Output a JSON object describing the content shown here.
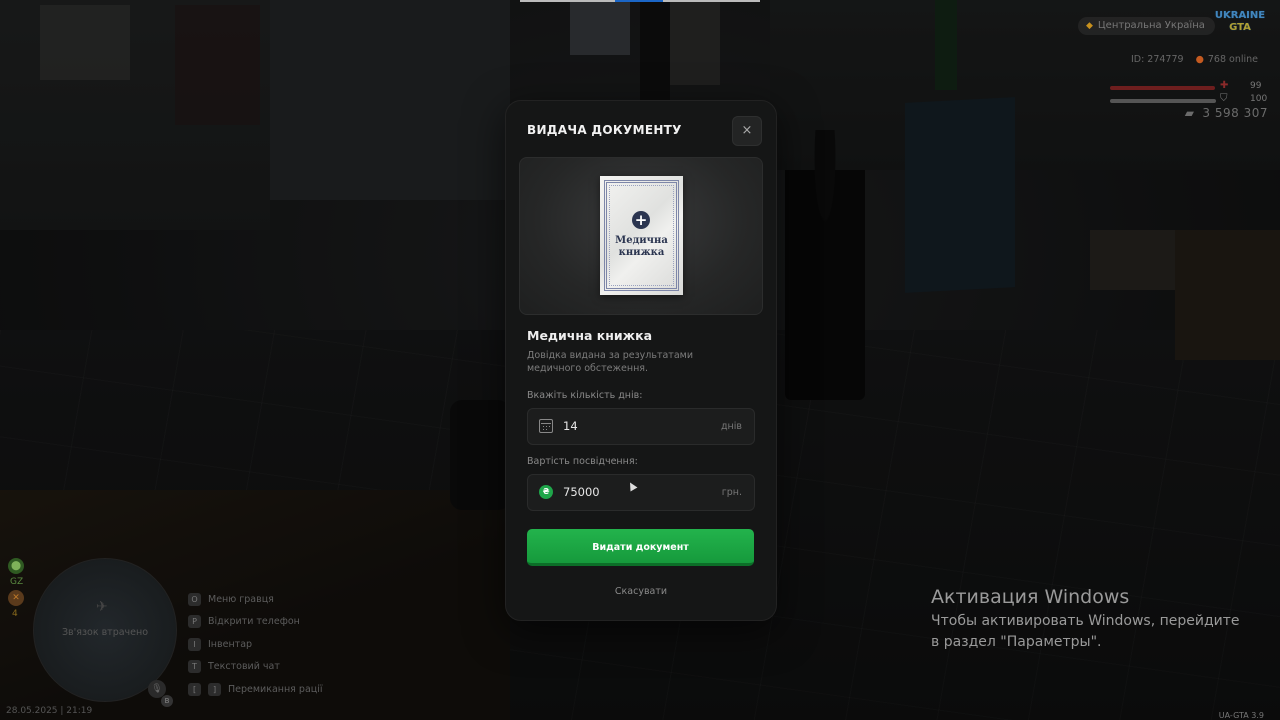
{
  "modal": {
    "title": "ВИДАЧА ДОКУМЕНТУ",
    "close_label": "×",
    "document_card_title": "Медична книжка",
    "document_name": "Медична книжка",
    "document_description": "Довідка видана за результатами медичного обстеження.",
    "days_field": {
      "label": "Вкажіть кількість днів:",
      "value": "14",
      "unit": "днів",
      "icon": "calendar-icon"
    },
    "price_field": {
      "label": "Вартість посвідчення:",
      "value": "75000",
      "unit": "грн.",
      "icon": "hryvnia-coin-icon",
      "icon_glyph": "₴"
    },
    "issue_button": "Видати документ",
    "cancel_button": "Скасувати",
    "accent_color": "#1fa64a"
  },
  "hud": {
    "region": "Центральна Україна",
    "logo_top": "UKRAINE",
    "logo_bottom": "GTA",
    "player_id": "ID: 274779",
    "online": "768 online",
    "health": "99",
    "armor": "100",
    "health_fill": 0.99,
    "armor_fill": 1.0,
    "money": "3 598 307",
    "left_text": "GZ",
    "left_count": "4",
    "minimap_text": "Зв'язок втрачено",
    "keys": [
      {
        "key": "O",
        "label": "Меню гравця"
      },
      {
        "key": "P",
        "label": "Відкрити телефон"
      },
      {
        "key": "I",
        "label": "Інвентар"
      },
      {
        "key": "T",
        "label": "Текстовий чат"
      },
      {
        "key1": "[",
        "key2": "]",
        "label": "Перемикання рації"
      }
    ],
    "datetime": "28.05.2025 | 21:19",
    "version": "UA-GTA 3.9"
  },
  "windows_activation": {
    "title": "Активация Windows",
    "subtitle": "Чтобы активировать Windows, перейдите в раздел \"Параметры\"."
  }
}
